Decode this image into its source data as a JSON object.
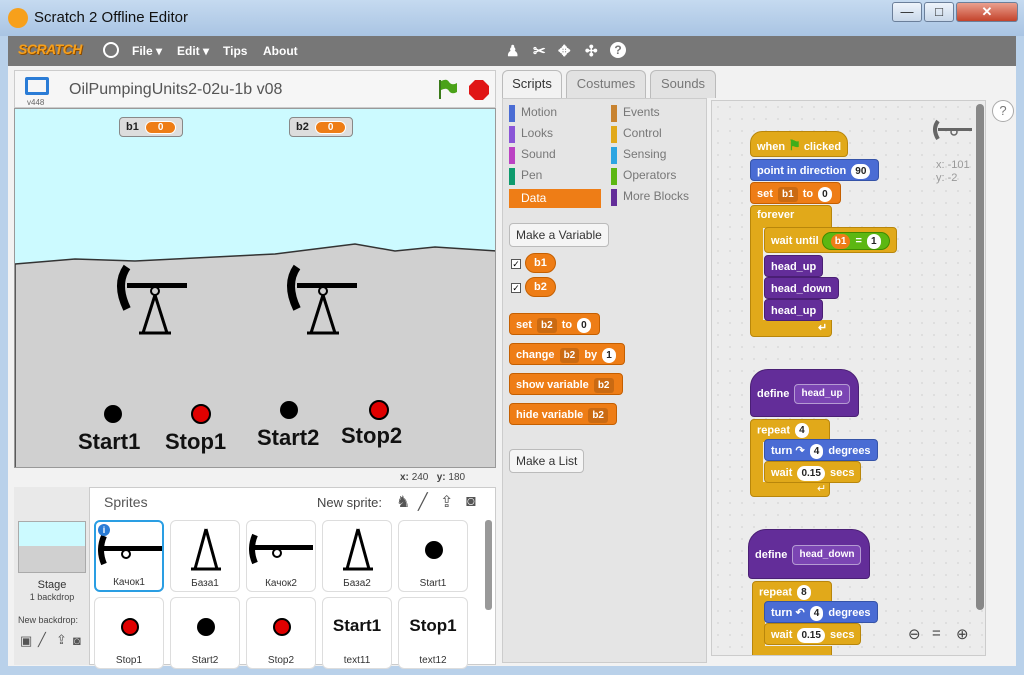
{
  "window": {
    "title": "Scratch 2 Offline Editor",
    "minimize": "—",
    "maximize": "□",
    "close": "✕"
  },
  "menubar": {
    "logo": "SCRATCH",
    "items": [
      "File ▾",
      "Edit ▾",
      "Tips",
      "About"
    ],
    "toolbar_icons": [
      "duplicate-icon",
      "delete-icon",
      "grow-icon",
      "shrink-icon",
      "help-icon"
    ]
  },
  "stage": {
    "project_title": "OilPumpingUnits2-02u-1b v08",
    "version": "v448",
    "monitors": [
      {
        "name": "b1",
        "value": "0"
      },
      {
        "name": "b2",
        "value": "0"
      }
    ],
    "texts": [
      "Start1",
      "Stop1",
      "Start2",
      "Stop2"
    ],
    "coords_x_label": "x:",
    "coords_x": "240",
    "coords_y_label": "y:",
    "coords_y": "180",
    "colors": {
      "sky": "#ccfaff",
      "ground": "#d0d0d0",
      "stop": "#e00000"
    }
  },
  "sprites_panel": {
    "title": "Sprites",
    "new_sprite_label": "New sprite:",
    "stage_label": "Stage",
    "stage_sub": "1 backdrop",
    "new_backdrop_label": "New backdrop:",
    "sprites": [
      {
        "name": "Качок1",
        "thumb": "pump-head"
      },
      {
        "name": "База1",
        "thumb": "pump-base"
      },
      {
        "name": "Качок2",
        "thumb": "pump-head"
      },
      {
        "name": "База2",
        "thumb": "pump-base"
      },
      {
        "name": "Start1",
        "thumb": "black-dot"
      },
      {
        "name": "Stop1",
        "thumb": "red-dot"
      },
      {
        "name": "Start2",
        "thumb": "black-dot"
      },
      {
        "name": "Stop2",
        "thumb": "red-dot"
      },
      {
        "name": "text11",
        "thumb": "Start1"
      },
      {
        "name": "text12",
        "thumb": "Stop1"
      }
    ]
  },
  "tabs": [
    "Scripts",
    "Costumes",
    "Sounds"
  ],
  "palette": {
    "categories_left": [
      {
        "label": "Motion",
        "color": "#4a6cd4"
      },
      {
        "label": "Looks",
        "color": "#8a55d7"
      },
      {
        "label": "Sound",
        "color": "#bb42c3"
      },
      {
        "label": "Pen",
        "color": "#0e9a6c"
      },
      {
        "label": "Data",
        "color": "#ee7d16"
      }
    ],
    "categories_right": [
      {
        "label": "Events",
        "color": "#c88330"
      },
      {
        "label": "Control",
        "color": "#e1a91a"
      },
      {
        "label": "Sensing",
        "color": "#2ca5e2"
      },
      {
        "label": "Operators",
        "color": "#5cb712"
      },
      {
        "label": "More Blocks",
        "color": "#632d99"
      }
    ],
    "make_variable": "Make a Variable",
    "variables": [
      "b1",
      "b2"
    ],
    "set_block": {
      "label": "set",
      "var": "b2",
      "to": "to",
      "value": "0"
    },
    "change_block": {
      "label": "change",
      "var": "b2",
      "by": "by",
      "value": "1"
    },
    "show_block": {
      "label": "show variable",
      "var": "b2"
    },
    "hide_block": {
      "label": "hide variable",
      "var": "b2"
    },
    "make_list": "Make a List"
  },
  "scripts": {
    "sprite_x": "x: -101",
    "sprite_y": "y: -2",
    "s1": {
      "hat": "when",
      "hat2": "clicked",
      "point": "point in direction",
      "point_val": "90",
      "set": "set",
      "set_var": "b1",
      "set_to": "to",
      "set_val": "0",
      "forever": "forever",
      "wait": "wait until",
      "cond_var": "b1",
      "cond_op": "=",
      "cond_val": "1",
      "c1": "head_up",
      "c2": "head_down",
      "c3": "head_up"
    },
    "s2": {
      "define": "define",
      "proc": "head_up",
      "repeat": "repeat",
      "repeat_val": "4",
      "turn": "turn",
      "turn_val": "4",
      "turn_unit": "degrees",
      "wait": "wait",
      "wait_val": "0.15",
      "wait_unit": "secs"
    },
    "s3": {
      "define": "define",
      "proc": "head_down",
      "repeat": "repeat",
      "repeat_val": "8",
      "turn": "turn",
      "turn_val": "4",
      "turn_unit": "degrees",
      "wait": "wait",
      "wait_val": "0.15",
      "wait_unit": "secs"
    }
  }
}
